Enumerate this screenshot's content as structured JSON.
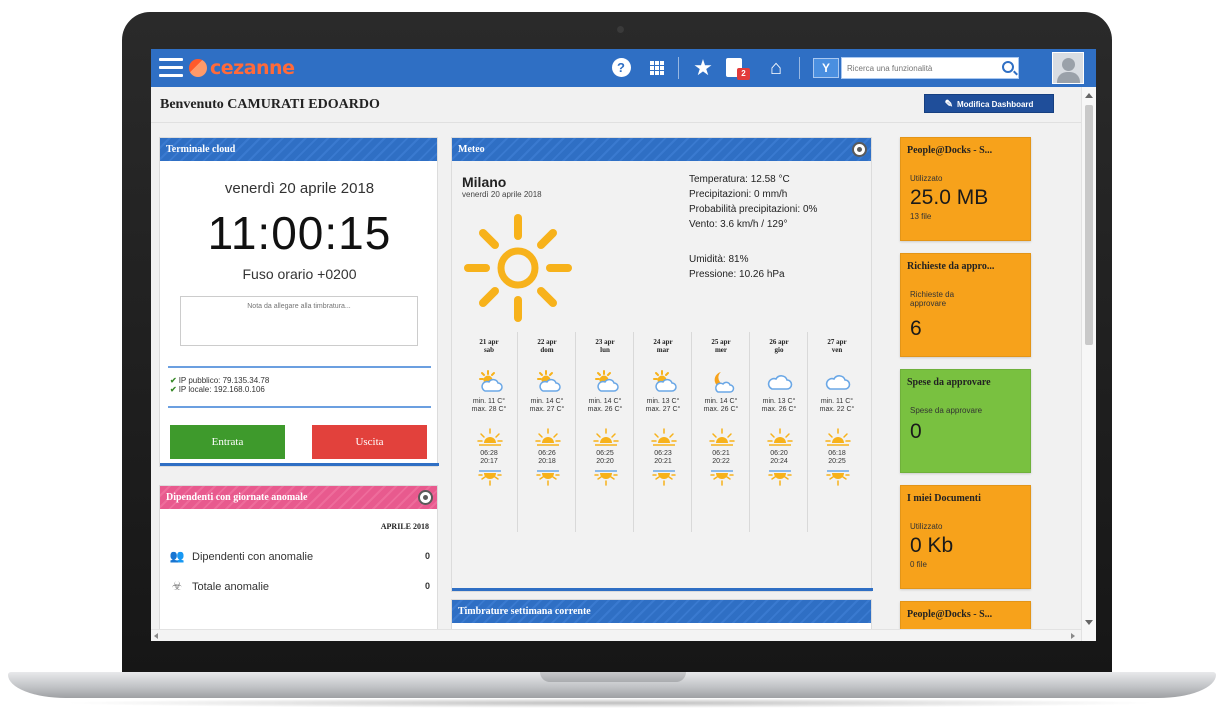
{
  "topbar": {
    "logo_text": "cezanne",
    "help_icon": "?",
    "tasks_badge": "2",
    "filter_label": "Y",
    "search_placeholder": "Ricerca una funzionalità"
  },
  "header": {
    "welcome": "Benvenuto CAMURATI EDOARDO",
    "modify_dashboard": "Modifica Dashboard"
  },
  "terminale": {
    "title": "Terminale cloud",
    "date": "venerdì 20 aprile 2018",
    "time": "11:00:15",
    "timezone": "Fuso orario +0200",
    "note_placeholder": "Nota da allegare alla timbratura...",
    "ip_public": "IP pubblico: 79.135.34.78",
    "ip_local": "IP locale: 192.168.0.106",
    "btn_in": "Entrata",
    "btn_out": "Uscita"
  },
  "dipendenti": {
    "title": "Dipendenti con giornate anomale",
    "month": "APRILE 2018",
    "rows": [
      {
        "label": "Dipendenti con anomalie",
        "value": "0"
      },
      {
        "label": "Totale anomalie",
        "value": "0"
      }
    ]
  },
  "meteo": {
    "title": "Meteo",
    "city": "Milano",
    "date": "venerdì 20 aprile 2018",
    "temperatura": "Temperatura: 12.58 °C",
    "precipitazioni": "Precipitazioni: 0 mm/h",
    "probabilita": "Probabilità precipitazioni: 0%",
    "vento": "Vento: 3.6 km/h / 129°",
    "umidita": "Umidità: 81%",
    "pressione": "Pressione: 10.26 hPa",
    "days": [
      {
        "date": "21 apr",
        "dow": "sab",
        "icon": "sun-cloud",
        "min": "min. 11 C°",
        "max": "max. 28 C°",
        "rise": "06:28",
        "set": "20:17"
      },
      {
        "date": "22 apr",
        "dow": "dom",
        "icon": "sun-cloud",
        "min": "min. 14 C°",
        "max": "max. 27 C°",
        "rise": "06:26",
        "set": "20:18"
      },
      {
        "date": "23 apr",
        "dow": "lun",
        "icon": "sun-cloud",
        "min": "min. 14 C°",
        "max": "max. 26 C°",
        "rise": "06:25",
        "set": "20:20"
      },
      {
        "date": "24 apr",
        "dow": "mar",
        "icon": "sun-cloud",
        "min": "min. 13 C°",
        "max": "max. 27 C°",
        "rise": "06:23",
        "set": "20:21"
      },
      {
        "date": "25 apr",
        "dow": "mer",
        "icon": "moon-cloud",
        "min": "min. 14 C°",
        "max": "max. 26 C°",
        "rise": "06:21",
        "set": "20:22"
      },
      {
        "date": "26 apr",
        "dow": "gio",
        "icon": "cloud",
        "min": "min. 13 C°",
        "max": "max. 26 C°",
        "rise": "06:20",
        "set": "20:24"
      },
      {
        "date": "27 apr",
        "dow": "ven",
        "icon": "cloud",
        "min": "min. 11 C°",
        "max": "max. 22 C°",
        "rise": "06:18",
        "set": "20:25"
      }
    ]
  },
  "timbrature": {
    "title": "Timbrature settimana corrente"
  },
  "tiles": [
    {
      "title": "People@Docks - S...",
      "sub": "Utilizzato",
      "big": "25.0 MB",
      "small": "13 file",
      "color": "#f7a21b"
    },
    {
      "title": "Richieste da appro...",
      "sub": "Richieste da approvare",
      "big": "6",
      "small": "",
      "color": "#f7a21b"
    },
    {
      "title": "Spese da approvare",
      "sub": "Spese da approvare",
      "big": "0",
      "small": "",
      "color": "#79c140"
    },
    {
      "title": "I miei Documenti",
      "sub": "Utilizzato",
      "big": "0 Kb",
      "small": "0 file",
      "color": "#f7a21b"
    },
    {
      "title": "People@Docks - S...",
      "sub": "",
      "big": "",
      "small": "",
      "color": "#f7a21b"
    }
  ],
  "colors": {
    "primary": "#2f6fc4",
    "orange": "#f7a21b",
    "green": "#79c140",
    "pink": "#e85a8e",
    "entrata": "#3e9a2c",
    "uscita": "#e2413c"
  }
}
